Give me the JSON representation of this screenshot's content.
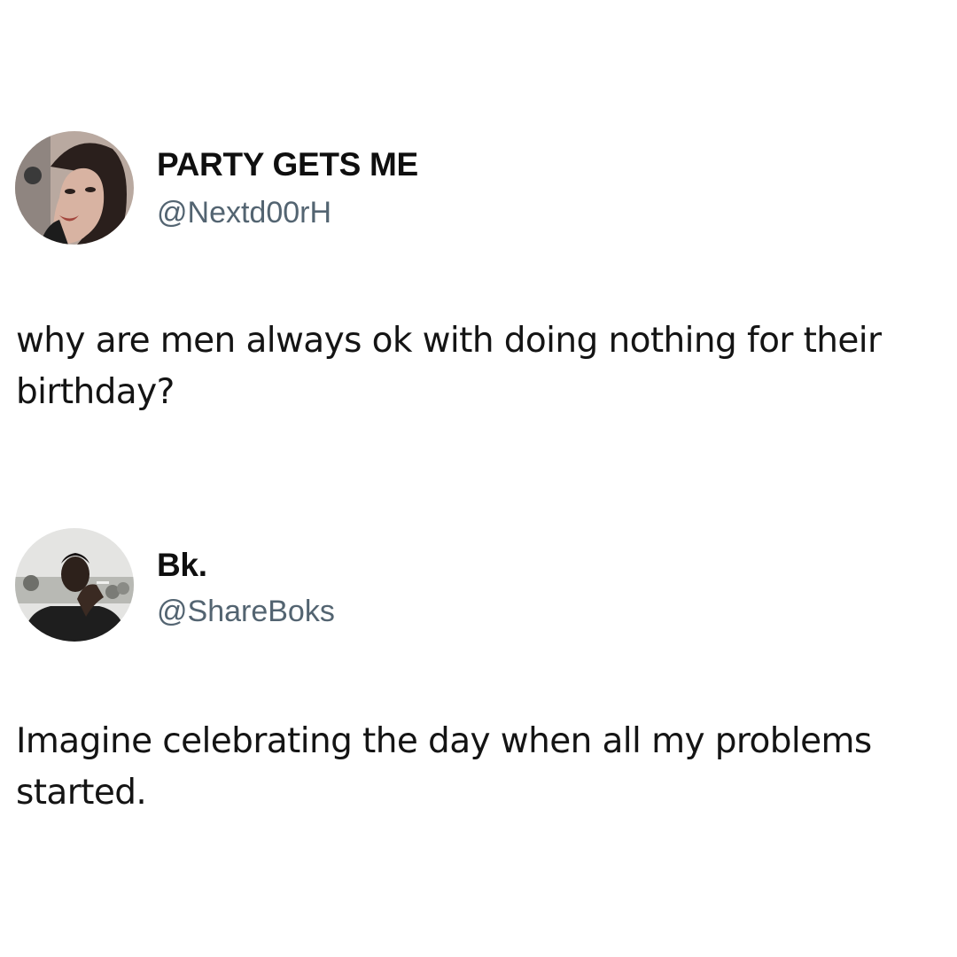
{
  "tweets": [
    {
      "display_name": "PARTY GETS ME",
      "handle": "@Nextd00rH",
      "text": "why are men always ok with doing nothing for their birthday?",
      "avatar_icon": "profile-photo-woman"
    },
    {
      "display_name": "Bk.",
      "handle": "@ShareBoks",
      "text": "Imagine celebrating the day when all my problems started.",
      "avatar_icon": "profile-photo-man"
    }
  ],
  "colors": {
    "background": "#ffffff",
    "text": "#141414",
    "handle": "#536471"
  }
}
